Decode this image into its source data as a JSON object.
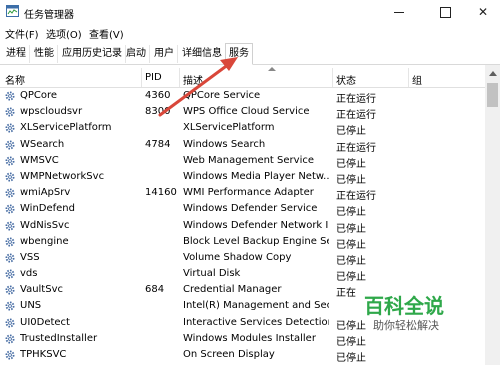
{
  "window": {
    "title": "任务管理器"
  },
  "menu": {
    "file": "文件(F)",
    "options": "选项(O)",
    "view": "查看(V)"
  },
  "tabs": [
    "进程",
    "性能",
    "应用历史记录",
    "启动",
    "用户",
    "详细信息",
    "服务"
  ],
  "active_tab": "服务",
  "columns": {
    "name": "名称",
    "pid": "PID",
    "description": "描述",
    "status": "状态",
    "group": "组"
  },
  "services": [
    {
      "name": "QPCore",
      "pid": "4360",
      "description": "QPCore Service",
      "status": "正在运行"
    },
    {
      "name": "wpscloudsvr",
      "pid": "8300",
      "description": "WPS Office Cloud Service",
      "status": "正在运行"
    },
    {
      "name": "XLServicePlatform",
      "pid": "",
      "description": "XLServicePlatform",
      "status": "已停止"
    },
    {
      "name": "WSearch",
      "pid": "4784",
      "description": "Windows Search",
      "status": "正在运行"
    },
    {
      "name": "WMSVC",
      "pid": "",
      "description": "Web Management Service",
      "status": "已停止"
    },
    {
      "name": "WMPNetworkSvc",
      "pid": "",
      "description": "Windows Media Player Netw...",
      "status": "已停止"
    },
    {
      "name": "wmiApSrv",
      "pid": "14160",
      "description": "WMI Performance Adapter",
      "status": "正在运行"
    },
    {
      "name": "WinDefend",
      "pid": "",
      "description": "Windows Defender Service",
      "status": "已停止"
    },
    {
      "name": "WdNisSvc",
      "pid": "",
      "description": "Windows Defender Network I...",
      "status": "已停止"
    },
    {
      "name": "wbengine",
      "pid": "",
      "description": "Block Level Backup Engine Se...",
      "status": "已停止"
    },
    {
      "name": "VSS",
      "pid": "",
      "description": "Volume Shadow Copy",
      "status": "已停止"
    },
    {
      "name": "vds",
      "pid": "",
      "description": "Virtual Disk",
      "status": "已停止"
    },
    {
      "name": "VaultSvc",
      "pid": "684",
      "description": "Credential Manager",
      "status": "正在"
    },
    {
      "name": "UNS",
      "pid": "",
      "description": "Intel(R) Management and Sec...",
      "status": ""
    },
    {
      "name": "UI0Detect",
      "pid": "",
      "description": "Interactive Services Detection",
      "status": "已停止"
    },
    {
      "name": "TrustedInstaller",
      "pid": "",
      "description": "Windows Modules Installer",
      "status": "已停止"
    },
    {
      "name": "TPHKSVC",
      "pid": "",
      "description": "On Screen Display",
      "status": "已停止"
    }
  ],
  "watermark": {
    "title": "百科全说",
    "subtitle": "助你轻松解决"
  },
  "colors": {
    "annotation_arrow": "#d9473a",
    "watermark_green": "#2fa84a",
    "gear_blue": "#4a6fa5"
  }
}
